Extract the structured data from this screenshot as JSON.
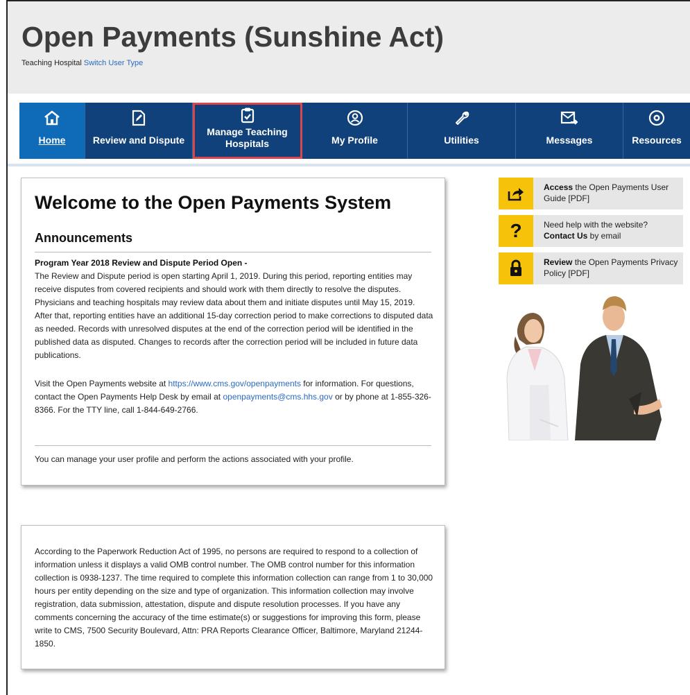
{
  "header": {
    "title": "Open Payments (Sunshine Act)",
    "user_type": "Teaching Hospital",
    "switch_link": "Switch User Type"
  },
  "nav": {
    "items": [
      {
        "label": "Home",
        "icon": "home-icon"
      },
      {
        "label": "Review and Dispute",
        "icon": "edit-document-icon"
      },
      {
        "label_line1": "Manage Teaching",
        "label_line2": "Hospitals",
        "icon": "clipboard-icon"
      },
      {
        "label": "My Profile",
        "icon": "user-profile-icon"
      },
      {
        "label": "Utilities",
        "icon": "wrench-icon"
      },
      {
        "label": "Messages",
        "icon": "envelope-icon"
      },
      {
        "label": "Resources",
        "icon": "gear-icon"
      }
    ]
  },
  "welcome": {
    "heading": "Welcome to the Open Payments System",
    "announcements_heading": "Announcements",
    "announcement_title": "Program Year 2018 Review and Dispute Period Open -",
    "announcement_body": "The Review and Dispute period is open starting April 1, 2019. During this period, reporting entities may receive disputes from covered recipients and should work with them directly to resolve the disputes. Physicians and teaching hospitals may review data about them and initiate disputes until May 15, 2019. After that, reporting entities have an additional 15-day correction period to make corrections to disputed data as needed. Records with unresolved disputes at the end of the correction period will be identified in the published data as disputed. Changes to records after the correction period will be included in future data publications.",
    "visit_prefix": "Visit the Open Payments website at ",
    "website_link": "https://www.cms.gov/openpayments",
    "visit_mid": " for information. For questions, contact the Open Payments Help Desk by email at ",
    "email_link": "openpayments@cms.hhs.gov",
    "visit_suffix": " or by phone at 1-855-326-8366. For the TTY line, call 1-844-649-2766.",
    "profile_note": "You can manage your user profile and perform the actions associated with your profile."
  },
  "pra": {
    "text": "According to the Paperwork Reduction Act of 1995, no persons are required to respond to a collection of information unless it displays a valid OMB control number. The OMB control number for this information collection is 0938-1237. The time required to complete this information collection can range from 1 to 30,000 hours per entity depending on the size and type of organization. This information collection may involve registration, data submission, attestation, dispute and dispute resolution processes. If you have any comments concerning the accuracy of the time estimate(s) or suggestions for improving this form, please write to CMS, 7500 Security Boulevard, Attn: PRA Reports Clearance Officer, Baltimore, Maryland 21244-1850."
  },
  "side_links": [
    {
      "bold": "Access",
      "rest": " the Open Payments User Guide [PDF]",
      "icon": "share-arrow-icon"
    },
    {
      "pre": "Need help with the website? ",
      "bold": "Contact Us",
      "rest": " by email",
      "icon": "question-mark-icon"
    },
    {
      "bold": "Review",
      "rest": " the Open Payments Privacy Policy [PDF]",
      "icon": "lock-icon"
    }
  ],
  "colors": {
    "nav_bg": "#10417a",
    "nav_active": "#0f6ab8",
    "highlight": "#d9474b",
    "side_icon_bg": "#f7c20a",
    "link": "#2a6ac0"
  }
}
